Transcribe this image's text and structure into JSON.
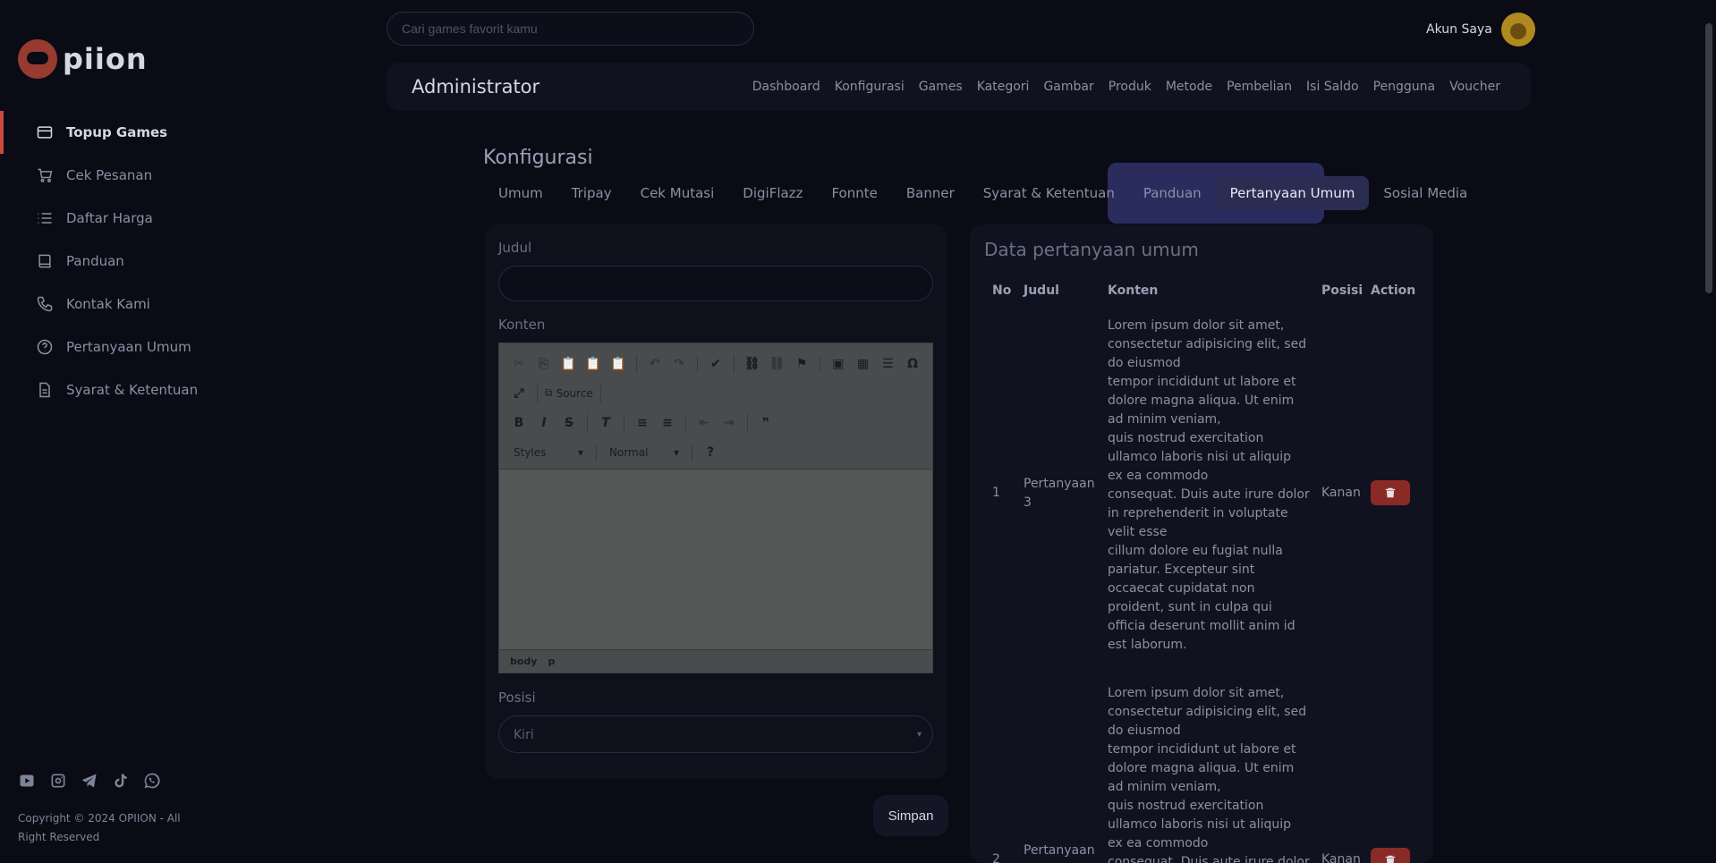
{
  "brand": {
    "name": "piion"
  },
  "sidebar": {
    "items": [
      {
        "label": "Topup Games",
        "icon": "card-icon"
      },
      {
        "label": "Cek Pesanan",
        "icon": "cart-icon"
      },
      {
        "label": "Daftar Harga",
        "icon": "list-icon"
      },
      {
        "label": "Panduan",
        "icon": "book-icon"
      },
      {
        "label": "Kontak Kami",
        "icon": "phone-icon"
      },
      {
        "label": "Pertanyaan Umum",
        "icon": "question-icon"
      },
      {
        "label": "Syarat & Ketentuan",
        "icon": "document-icon"
      }
    ],
    "copyright": "Copyright © 2024 OPIION - All Right Reserved"
  },
  "search": {
    "placeholder": "Cari games favorit kamu"
  },
  "account": {
    "label": "Akun Saya"
  },
  "admin": {
    "title": "Administrator",
    "nav": [
      "Dashboard",
      "Konfigurasi",
      "Games",
      "Kategori",
      "Gambar",
      "Produk",
      "Metode",
      "Pembelian",
      "Isi Saldo",
      "Pengguna",
      "Voucher"
    ]
  },
  "config": {
    "title": "Konfigurasi",
    "tabs": [
      "Umum",
      "Tripay",
      "Cek Mutasi",
      "DigiFlazz",
      "Fonnte",
      "Banner",
      "Syarat & Ketentuan",
      "Panduan",
      "Pertanyaan Umum",
      "Sosial Media"
    ],
    "active_tab": "Pertanyaan Umum"
  },
  "form": {
    "judul_label": "Judul",
    "judul_value": "",
    "konten_label": "Konten",
    "editor": {
      "source_label": "Source",
      "styles_label": "Styles",
      "format_label": "Normal",
      "help_label": "?",
      "path": [
        "body",
        "p"
      ]
    },
    "posisi_label": "Posisi",
    "posisi_value": "Kiri",
    "submit_label": "Simpan"
  },
  "data_table": {
    "title": "Data pertanyaan umum",
    "headers": [
      "No",
      "Judul",
      "Konten",
      "Posisi",
      "Action"
    ],
    "rows": [
      {
        "no": "1",
        "judul": "Pertanyaan 3",
        "konten": "Lorem ipsum dolor sit amet, consectetur adipisicing elit, sed do eiusmod\ntempor incididunt ut labore et dolore magna aliqua. Ut enim ad minim veniam,\nquis nostrud exercitation ullamco laboris nisi ut aliquip ex ea commodo\nconsequat. Duis aute irure dolor in reprehenderit in voluptate velit esse\ncillum dolore eu fugiat nulla pariatur. Excepteur sint occaecat cupidatat non\nproident, sunt in culpa qui officia deserunt mollit anim id est laborum.",
        "posisi": "Kanan"
      },
      {
        "no": "2",
        "judul": "Pertanyaan",
        "konten": "Lorem ipsum dolor sit amet, consectetur adipisicing elit, sed do eiusmod\ntempor incididunt ut labore et dolore magna aliqua. Ut enim ad minim veniam,\nquis nostrud exercitation ullamco laboris nisi ut aliquip ex ea commodo\nconsequat. Duis aute irure dolor in",
        "posisi": "Kanan"
      }
    ]
  },
  "colors": {
    "background": "#0a0b15",
    "accent": "#c84a3a",
    "tab_active": "#2a2c52",
    "delete": "#8a2a26"
  }
}
